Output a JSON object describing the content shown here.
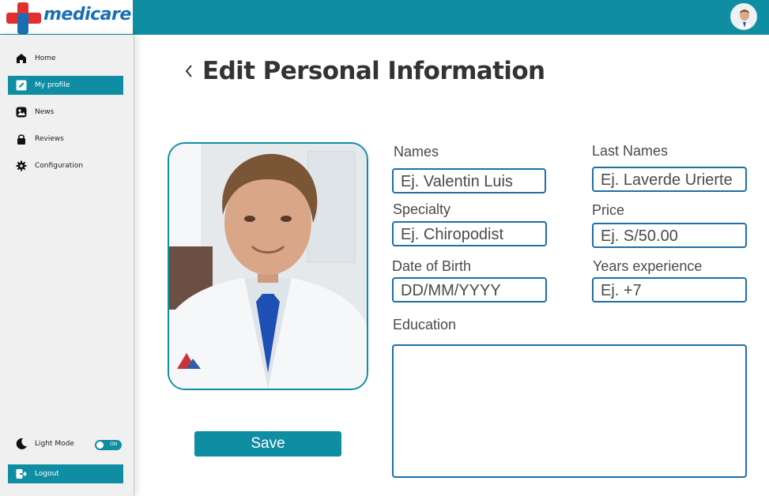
{
  "app": {
    "brand": "medicare"
  },
  "colors": {
    "accent": "#0e8da3",
    "field_border": "#1d6fa8",
    "logo_red": "#e1302f",
    "logo_blue": "#1a6fb4"
  },
  "sidebar": {
    "items": [
      {
        "label": "Home",
        "icon": "home-icon",
        "active": false
      },
      {
        "label": "My profile",
        "icon": "edit-icon",
        "active": true
      },
      {
        "label": "News",
        "icon": "image-icon",
        "active": false
      },
      {
        "label": "Reviews",
        "icon": "lock-icon",
        "active": false
      },
      {
        "label": "Configuration",
        "icon": "gear-icon",
        "active": false
      }
    ],
    "light_mode_label": "Light Mode",
    "toggle_state": "ON",
    "logout_label": "Logout"
  },
  "main": {
    "title": "Edit Personal Information",
    "save_label": "Save",
    "form": {
      "names": {
        "label": "Names",
        "placeholder": "Ej. Valentin Luis"
      },
      "last_names": {
        "label": "Last Names",
        "placeholder": "Ej. Laverde Urierte"
      },
      "specialty": {
        "label": "Specialty",
        "placeholder": "Ej. Chiropodist"
      },
      "price": {
        "label": "Price",
        "placeholder": "Ej. S/50.00"
      },
      "dob": {
        "label": "Date of Birth",
        "placeholder": "DD/MM/YYYY"
      },
      "years": {
        "label": "Years experience",
        "placeholder": "Ej. +7"
      },
      "education": {
        "label": "Education",
        "placeholder": ""
      }
    }
  }
}
